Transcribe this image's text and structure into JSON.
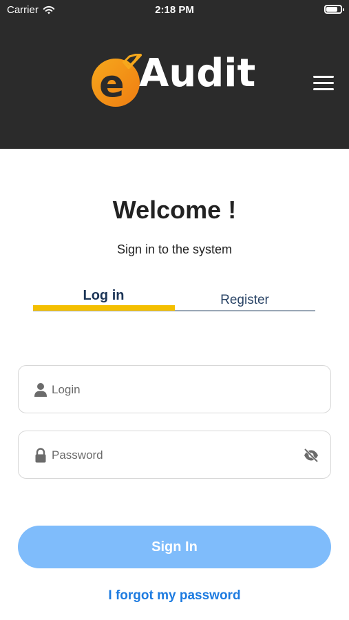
{
  "status_bar": {
    "carrier": "Carrier",
    "time": "2:18 PM",
    "battery_level": 0.8
  },
  "header": {
    "logo_text": "Audit",
    "logo_letter": "e",
    "menu_icon": "hamburger-menu-icon"
  },
  "main": {
    "title": "Welcome !",
    "subtitle": "Sign in to the system"
  },
  "tabs": [
    {
      "label": "Log in",
      "active": true
    },
    {
      "label": "Register",
      "active": false
    }
  ],
  "form": {
    "login": {
      "placeholder": "Login",
      "value": "",
      "icon": "person-icon"
    },
    "password": {
      "placeholder": "Password",
      "value": "",
      "icon": "lock-icon",
      "toggle_icon": "eye-slash-icon"
    }
  },
  "actions": {
    "sign_in_label": "Sign In",
    "forgot_password_label": "I forgot my password"
  },
  "colors": {
    "header_bg": "#2b2b2b",
    "accent_yellow": "#f4bf00",
    "logo_orange": "#f29a14",
    "button_blue": "#7fbcfb",
    "link_blue": "#1d7be0"
  }
}
